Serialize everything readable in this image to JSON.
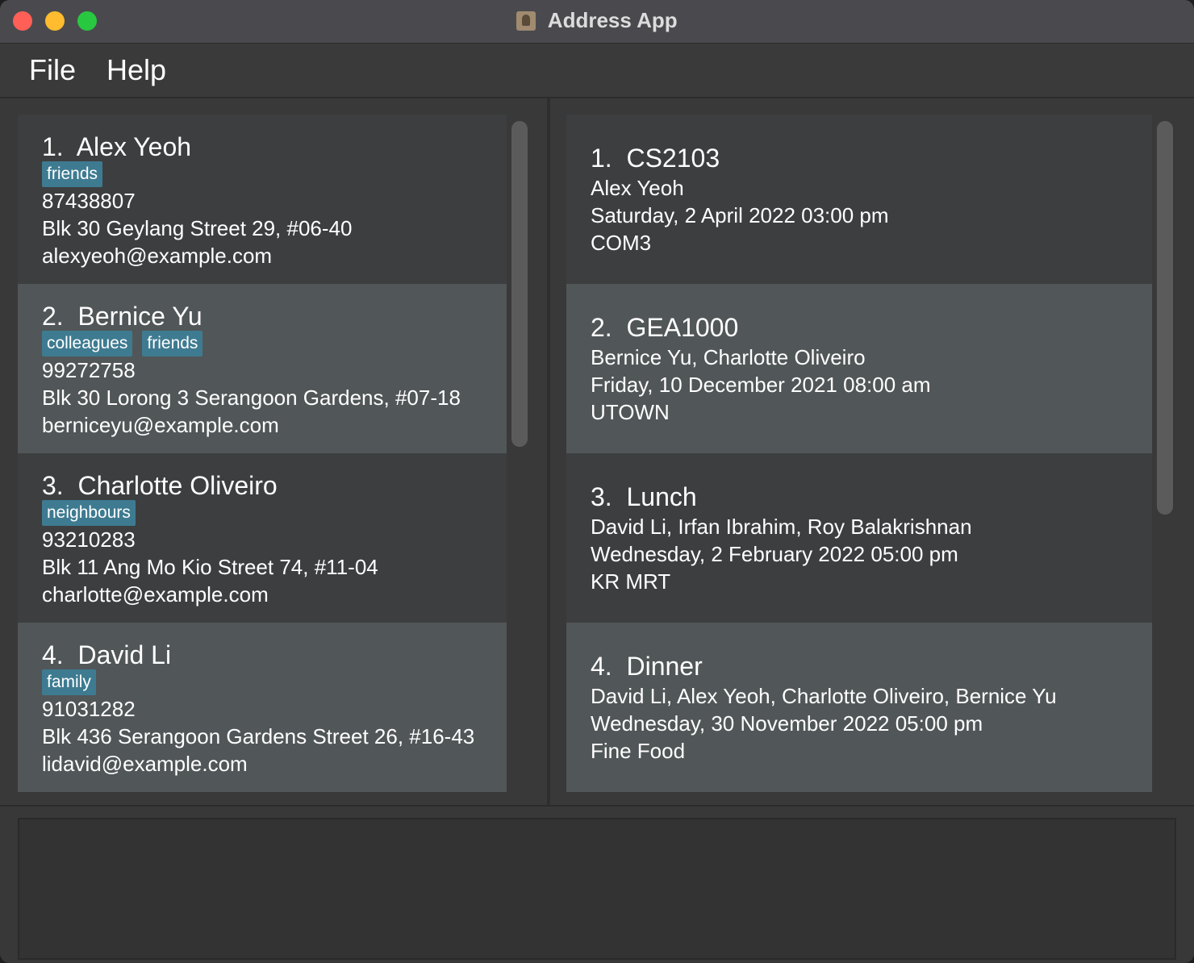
{
  "window": {
    "title": "Address App",
    "title_icon": "address-book-icon"
  },
  "menu": {
    "file": "File",
    "help": "Help"
  },
  "persons": [
    {
      "index": "1.",
      "name": "Alex Yeoh",
      "tags": [
        "friends"
      ],
      "phone": "87438807",
      "address": "Blk 30 Geylang Street 29, #06-40",
      "email": "alexyeoh@example.com"
    },
    {
      "index": "2.",
      "name": "Bernice Yu",
      "tags": [
        "colleagues",
        "friends"
      ],
      "phone": "99272758",
      "address": "Blk 30 Lorong 3 Serangoon Gardens, #07-18",
      "email": "berniceyu@example.com"
    },
    {
      "index": "3.",
      "name": "Charlotte Oliveiro",
      "tags": [
        "neighbours"
      ],
      "phone": "93210283",
      "address": "Blk 11 Ang Mo Kio Street 74, #11-04",
      "email": "charlotte@example.com"
    },
    {
      "index": "4.",
      "name": "David Li",
      "tags": [
        "family"
      ],
      "phone": "91031282",
      "address": "Blk 436 Serangoon Gardens Street 26, #16-43",
      "email": "lidavid@example.com"
    }
  ],
  "events": [
    {
      "index": "1.",
      "name": "CS2103",
      "people": "Alex Yeoh",
      "datetime": "Saturday, 2 April 2022 03:00 pm",
      "venue": "COM3"
    },
    {
      "index": "2.",
      "name": "GEA1000",
      "people": "Bernice Yu, Charlotte Oliveiro",
      "datetime": "Friday, 10 December 2021 08:00 am",
      "venue": "UTOWN"
    },
    {
      "index": "3.",
      "name": "Lunch",
      "people": "David Li, Irfan Ibrahim, Roy Balakrishnan",
      "datetime": "Wednesday, 2 February 2022 05:00 pm",
      "venue": "KR MRT"
    },
    {
      "index": "4.",
      "name": "Dinner",
      "people": "David Li, Alex Yeoh, Charlotte Oliveiro, Bernice Yu",
      "datetime": "Wednesday, 30 November 2022 05:00 pm",
      "venue": "Fine Food"
    }
  ],
  "result_display": "",
  "colors": {
    "tag_background": "#3e7b91",
    "card_odd": "#3d3e40",
    "card_even": "#515658",
    "traffic_close": "#ff5f57",
    "traffic_minimize": "#febc2e",
    "traffic_zoom": "#28c840"
  }
}
